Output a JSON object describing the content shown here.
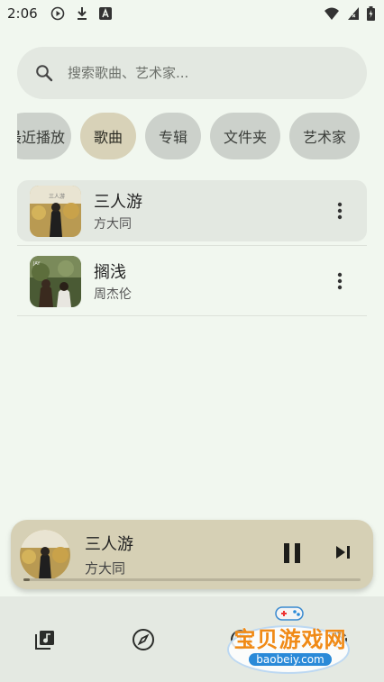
{
  "status_bar": {
    "time": "2:06",
    "left_icons": [
      "play-circle-icon",
      "download-icon",
      "font-icon"
    ],
    "right_icons": [
      "wifi-icon",
      "signal-icon",
      "battery-icon"
    ]
  },
  "search": {
    "placeholder": "搜索歌曲、艺术家..."
  },
  "chips": [
    {
      "label": "最近播放",
      "active": false
    },
    {
      "label": "歌曲",
      "active": true
    },
    {
      "label": "专辑",
      "active": false
    },
    {
      "label": "文件夹",
      "active": false
    },
    {
      "label": "艺术家",
      "active": false
    }
  ],
  "songs": [
    {
      "title": "三人游",
      "artist": "方大同",
      "selected": true
    },
    {
      "title": "搁浅",
      "artist": "周杰伦",
      "selected": false
    }
  ],
  "now_playing": {
    "title": "三人游",
    "artist": "方大同",
    "progress": 0.02,
    "state": "playing"
  },
  "bottom_nav": [
    {
      "icon": "music-library-icon"
    },
    {
      "icon": "compass-icon"
    },
    {
      "icon": "history-icon"
    },
    {
      "icon": "settings-icon"
    }
  ],
  "watermark": {
    "main": "宝贝游戏网",
    "sub": "baobeiy.com"
  },
  "colors": {
    "background": "#f1f7ef",
    "search_bg": "#e3e8e1",
    "chip_bg": "#ccd1cb",
    "chip_active_bg": "#d8d2b8",
    "player_bg": "#d6d0b5",
    "nav_bg": "#e4e9e2"
  }
}
